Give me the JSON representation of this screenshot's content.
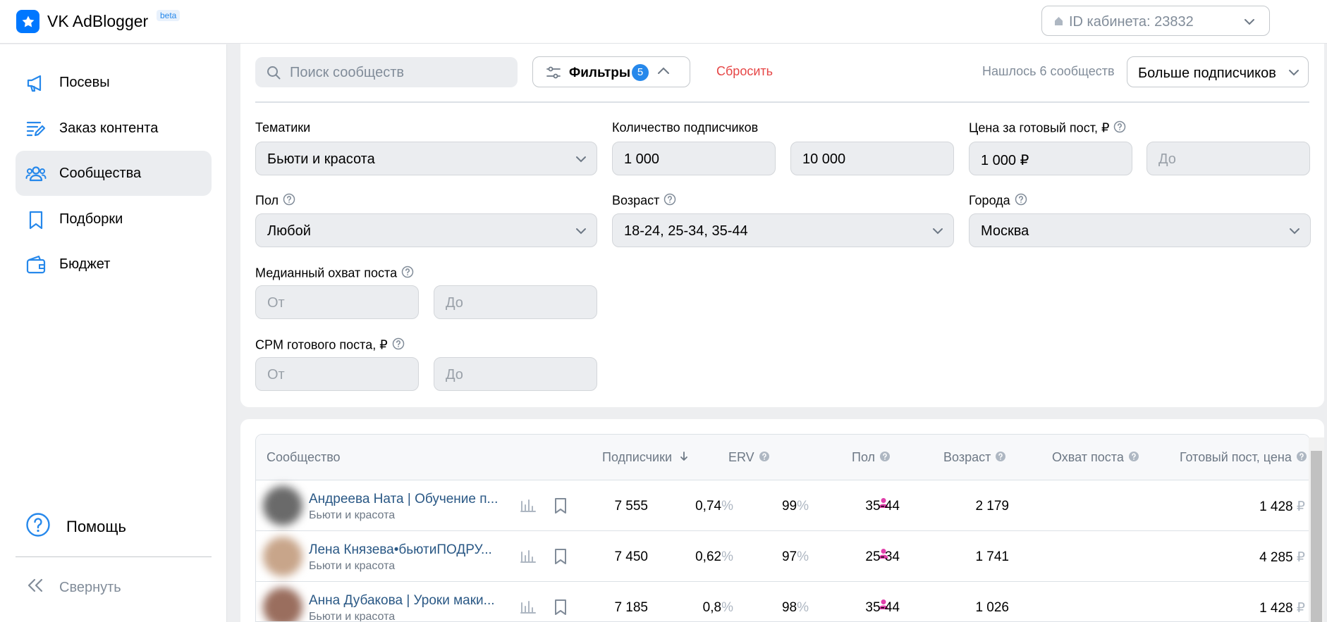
{
  "header": {
    "app_name": "VK AdBlogger",
    "beta": "beta",
    "cabinet": "ID кабинета: 23832"
  },
  "sidebar": {
    "items": [
      {
        "label": "Посевы",
        "icon": "megaphone-icon"
      },
      {
        "label": "Заказ контента",
        "icon": "edit-list-icon"
      },
      {
        "label": "Сообщества",
        "icon": "users-icon"
      },
      {
        "label": "Подборки",
        "icon": "bookmark-icon"
      },
      {
        "label": "Бюджет",
        "icon": "wallet-icon"
      }
    ],
    "help": "Помощь",
    "collapse": "Свернуть"
  },
  "toolbar": {
    "search_placeholder": "Поиск сообществ",
    "filters_label": "Фильтры",
    "filters_count": "5",
    "reset": "Сбросить",
    "found": "Нашлось 6 сообществ",
    "sort": "Больше подписчиков"
  },
  "filters": {
    "topics_label": "Тематики",
    "topics_value": "Бьюти и красота",
    "subscribers_label": "Количество подписчиков",
    "subscribers_from": "1 000",
    "subscribers_to": "10 000",
    "price_label": "Цена за готовый пост, ₽",
    "price_from": "1 000 ₽",
    "price_to_placeholder": "До",
    "gender_label": "Пол",
    "gender_value": "Любой",
    "age_label": "Возраст",
    "age_value": "18-24, 25-34, 35-44",
    "cities_label": "Города",
    "cities_value": "Москва",
    "reach_label": "Медианный охват поста",
    "reach_from_placeholder": "От",
    "reach_to_placeholder": "До",
    "cpm_label": "CPM готового поста, ₽",
    "cpm_from_placeholder": "От",
    "cpm_to_placeholder": "До"
  },
  "table": {
    "columns": {
      "community": "Сообщество",
      "subscribers": "Подписчики",
      "erv": "ERV",
      "gender": "Пол",
      "age": "Возраст",
      "reach": "Охват поста",
      "price": "Готовый пост, цена"
    },
    "rows": [
      {
        "name": "Андреева Ната | Обучение п...",
        "category": "Бьюти и красота",
        "subscribers": "7 555",
        "erv": "0,74",
        "gender": "99",
        "age": "35-44",
        "reach": "2 179",
        "price": "1 428",
        "avatar_color": "#6a6a6a"
      },
      {
        "name": "Лена Князева•бьютиПОДРУ...",
        "category": "Бьюти и красота",
        "subscribers": "7 450",
        "erv": "0,62",
        "gender": "97",
        "age": "25-34",
        "reach": "1 741",
        "price": "4 285",
        "avatar_color": "#c8a58a"
      },
      {
        "name": "Анна Дубакова | Уроки маки...",
        "category": "Бьюти и красота",
        "subscribers": "7 185",
        "erv": "0,8",
        "gender": "98",
        "age": "35-44",
        "reach": "1 026",
        "price": "1 428",
        "avatar_color": "#9a6e5e"
      }
    ],
    "pct": "%",
    "rub": "₽"
  },
  "colors": {
    "accent": "#2688eb",
    "link": "#2a5885",
    "danger": "#e64646",
    "female": "#e03fab"
  }
}
